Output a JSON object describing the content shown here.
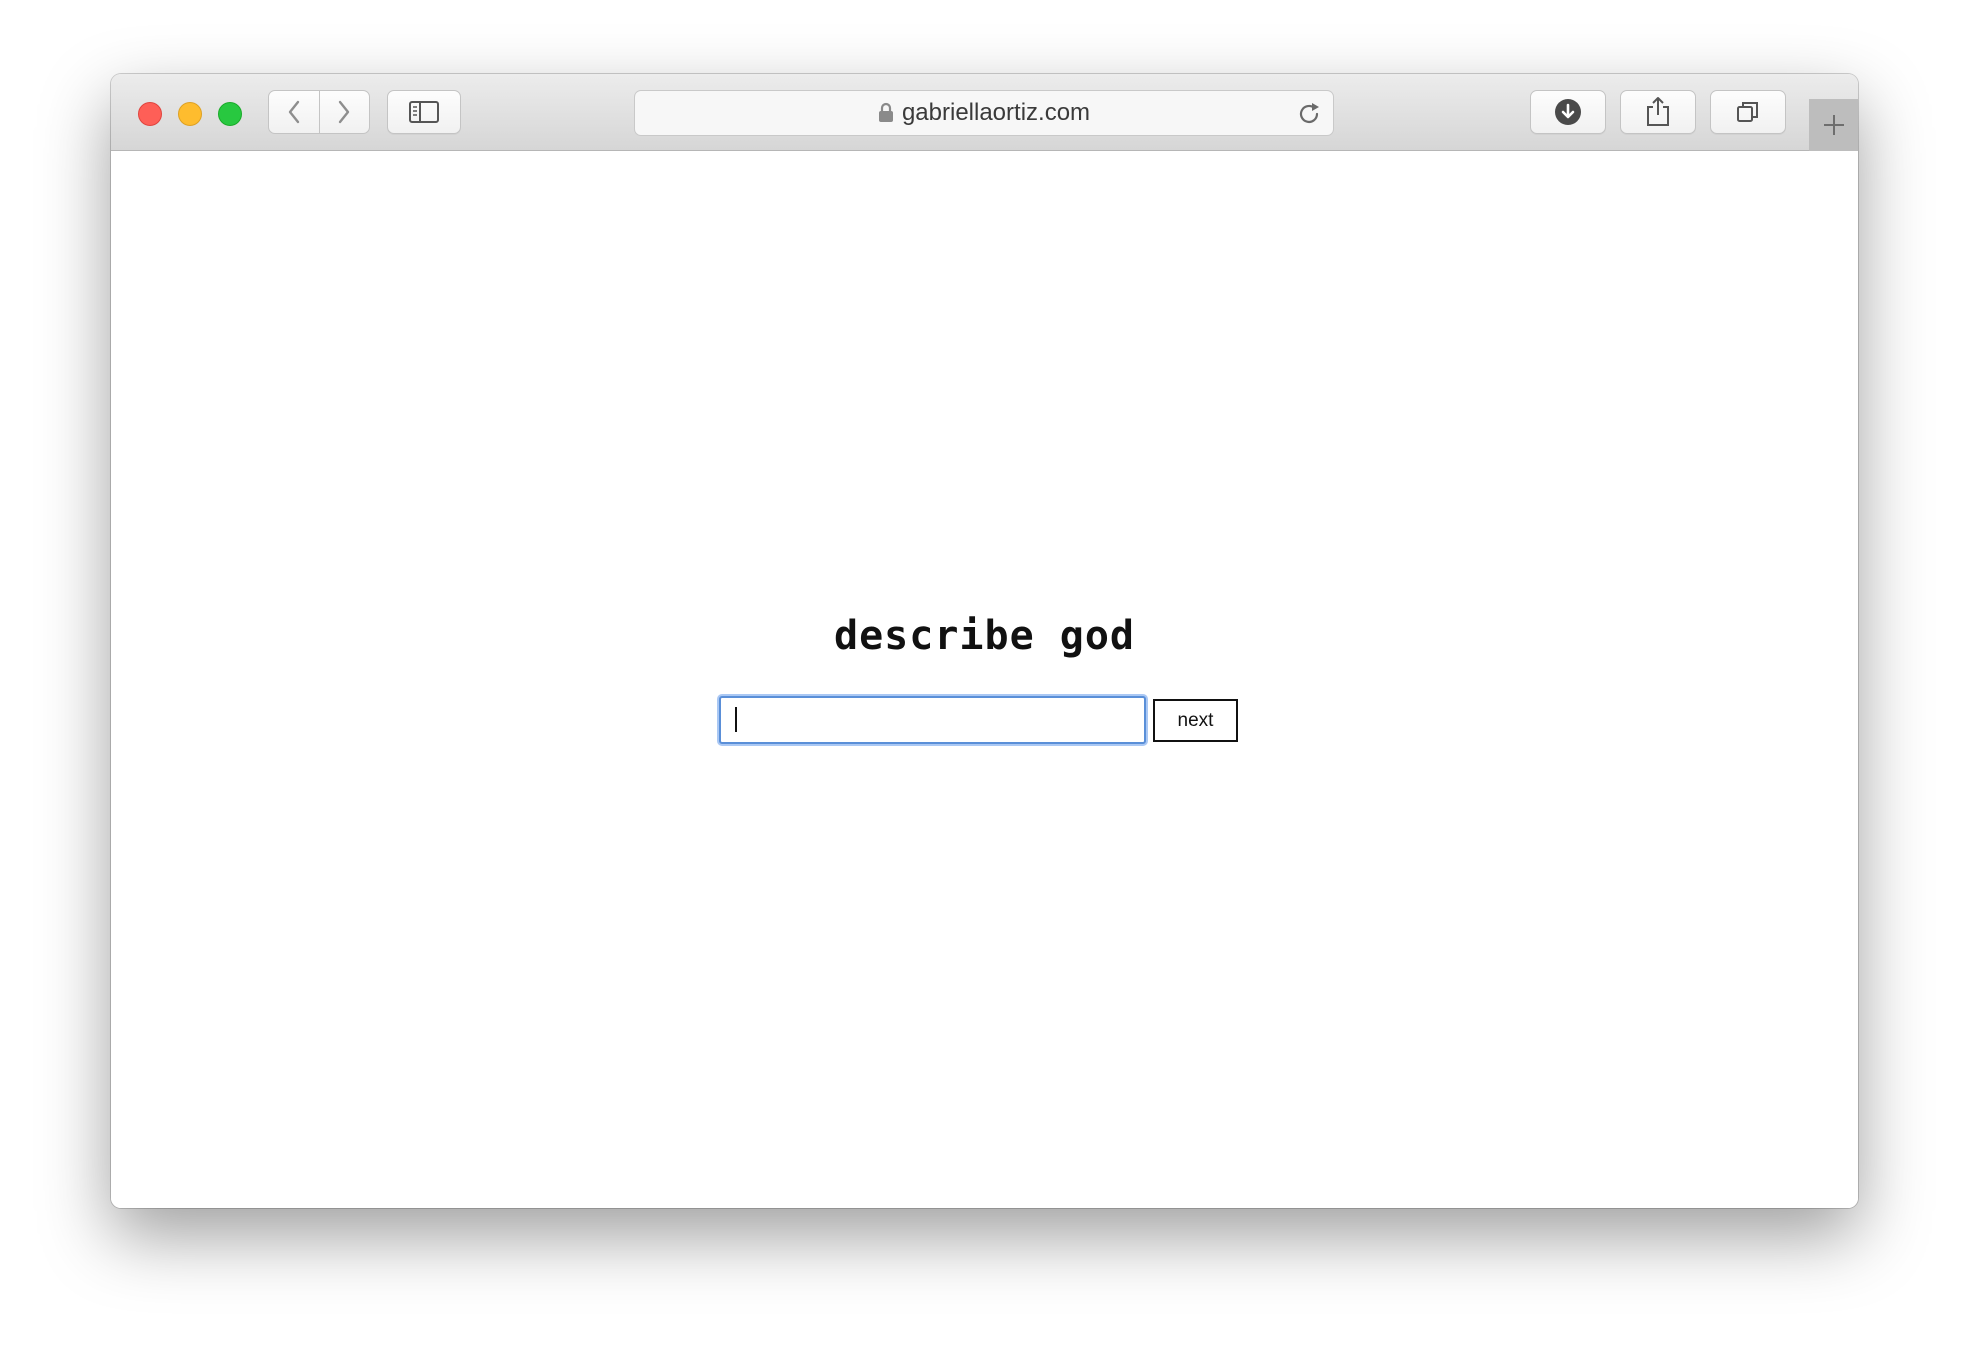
{
  "browser": {
    "address_bar": {
      "url": "gabriellaortiz.com",
      "secure": true
    },
    "icons": {
      "back": "chevron-left-icon",
      "forward": "chevron-right-icon",
      "sidebar": "sidebar-icon",
      "lock": "lock-icon",
      "reload": "reload-icon",
      "downloads": "download-icon",
      "share": "share-icon",
      "tabs": "tabs-overview-icon",
      "new_tab": "plus-icon"
    },
    "traffic_lights": {
      "close_color": "#fe5f57",
      "minimize_color": "#febc2e",
      "maximize_color": "#28c840"
    }
  },
  "page": {
    "heading": "describe god",
    "answer_input": {
      "value": "",
      "placeholder": "",
      "focused": true,
      "focus_color": "#5a8fd8"
    },
    "next_button": {
      "label": "next"
    }
  }
}
